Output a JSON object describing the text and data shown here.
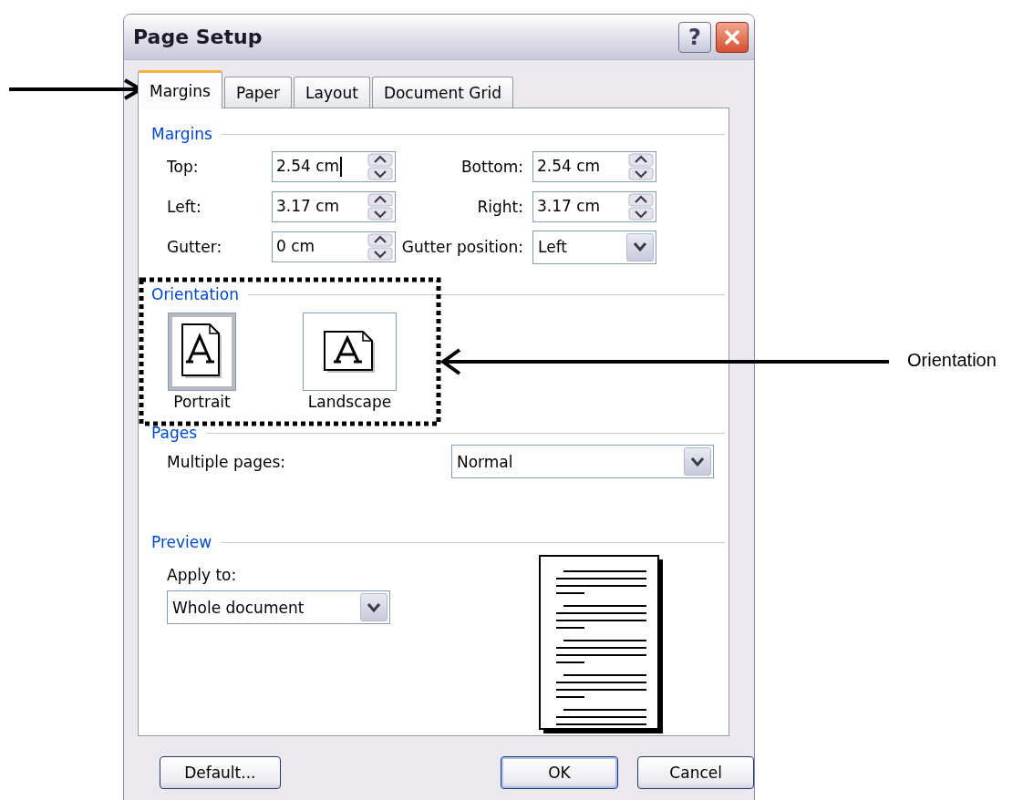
{
  "window": {
    "title": "Page Setup",
    "help_button": "?"
  },
  "tabs": [
    {
      "label": "Margins",
      "selected": true
    },
    {
      "label": "Paper",
      "selected": false
    },
    {
      "label": "Layout",
      "selected": false
    },
    {
      "label": "Document Grid",
      "selected": false
    }
  ],
  "margins": {
    "title": "Margins",
    "fields": [
      {
        "label": "Top:",
        "value": "2.54 cm",
        "kind": "spin",
        "focused": true
      },
      {
        "label": "Bottom:",
        "value": "2.54 cm",
        "kind": "spin",
        "focused": false
      },
      {
        "label": "Left:",
        "value": "3.17 cm",
        "kind": "spin",
        "focused": false
      },
      {
        "label": "Right:",
        "value": "3.17 cm",
        "kind": "spin",
        "focused": false
      },
      {
        "label": "Gutter:",
        "value": "0 cm",
        "kind": "spin",
        "focused": false
      },
      {
        "label": "Gutter position:",
        "value": "Left",
        "kind": "combo",
        "focused": false
      }
    ]
  },
  "orientation": {
    "title": "Orientation",
    "options": [
      {
        "label": "Portrait",
        "kind": "portrait",
        "selected": true
      },
      {
        "label": "Landscape",
        "kind": "landscape",
        "selected": false
      }
    ]
  },
  "pages": {
    "title": "Pages",
    "label": "Multiple pages:",
    "value": "Normal"
  },
  "preview": {
    "title": "Preview",
    "label": "Apply to:",
    "value": "Whole document"
  },
  "buttons": [
    {
      "label": "Default...",
      "default": false
    },
    {
      "label": "OK",
      "default": true
    },
    {
      "label": "Cancel",
      "default": false
    }
  ],
  "annotation": {
    "label": "Orientation"
  }
}
